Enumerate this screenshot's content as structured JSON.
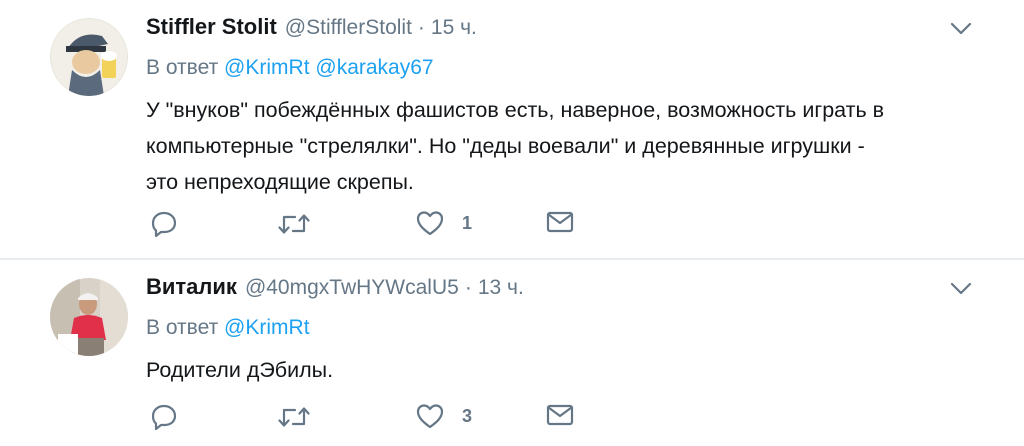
{
  "colors": {
    "link": "#1da1f2",
    "secondary": "#657786",
    "text": "#14171a",
    "divider": "#e6ecf0"
  },
  "tweets": [
    {
      "name": "Stiffler Stolit",
      "handle": "@StifflerStolit",
      "time": "15 ч.",
      "reply_prefix": "В ответ",
      "mentions": [
        "@KrimRt",
        "@karakay67"
      ],
      "text_lines": [
        "У \"внуков\" побеждённых фашистов есть, наверное, возможность играть в",
        "компьютерные \"стрелялки\". Но \"деды воевали\" и деревянные игрушки -",
        "это непреходящие скрепы."
      ],
      "like_count": "1",
      "icons": [
        "reply-icon",
        "retweet-icon",
        "heart-icon",
        "envelope-icon",
        "chevron-down-icon"
      ]
    },
    {
      "name": "Виталик",
      "handle": "@40mgxTwHYWcalU5",
      "time": "13 ч.",
      "reply_prefix": "В ответ",
      "mentions": [
        "@KrimRt"
      ],
      "text_lines": [
        "Родители дЭбилы."
      ],
      "like_count": "3",
      "icons": [
        "reply-icon",
        "retweet-icon",
        "heart-icon",
        "envelope-icon",
        "chevron-down-icon"
      ]
    }
  ],
  "separator": "·"
}
